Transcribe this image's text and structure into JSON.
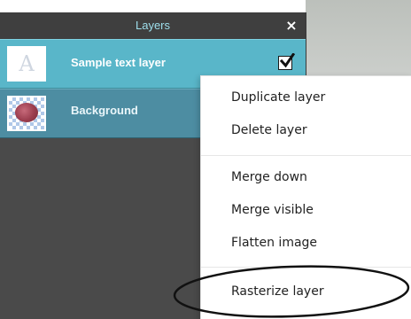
{
  "layers_panel": {
    "title": "Layers",
    "close_glyph": "×",
    "layers": [
      {
        "name": "Sample text layer",
        "selected": true,
        "visible": true,
        "thumbnail": "text-layer-thumbnail",
        "thumb_glyph": "A"
      },
      {
        "name": "Background",
        "selected": false,
        "thumbnail": "image-thumbnail"
      }
    ]
  },
  "context_menu": {
    "groups": [
      [
        "Duplicate layer",
        "Delete layer"
      ],
      [
        "Merge down",
        "Merge visible",
        "Flatten image"
      ],
      [
        "Rasterize layer"
      ]
    ],
    "highlighted_item": "Rasterize layer"
  },
  "colors": {
    "panel_header_text": "#9edfec",
    "selected_row": "#59b6c9",
    "background_row": "#4d8da2",
    "panel_bg": "#4a4a4a"
  }
}
